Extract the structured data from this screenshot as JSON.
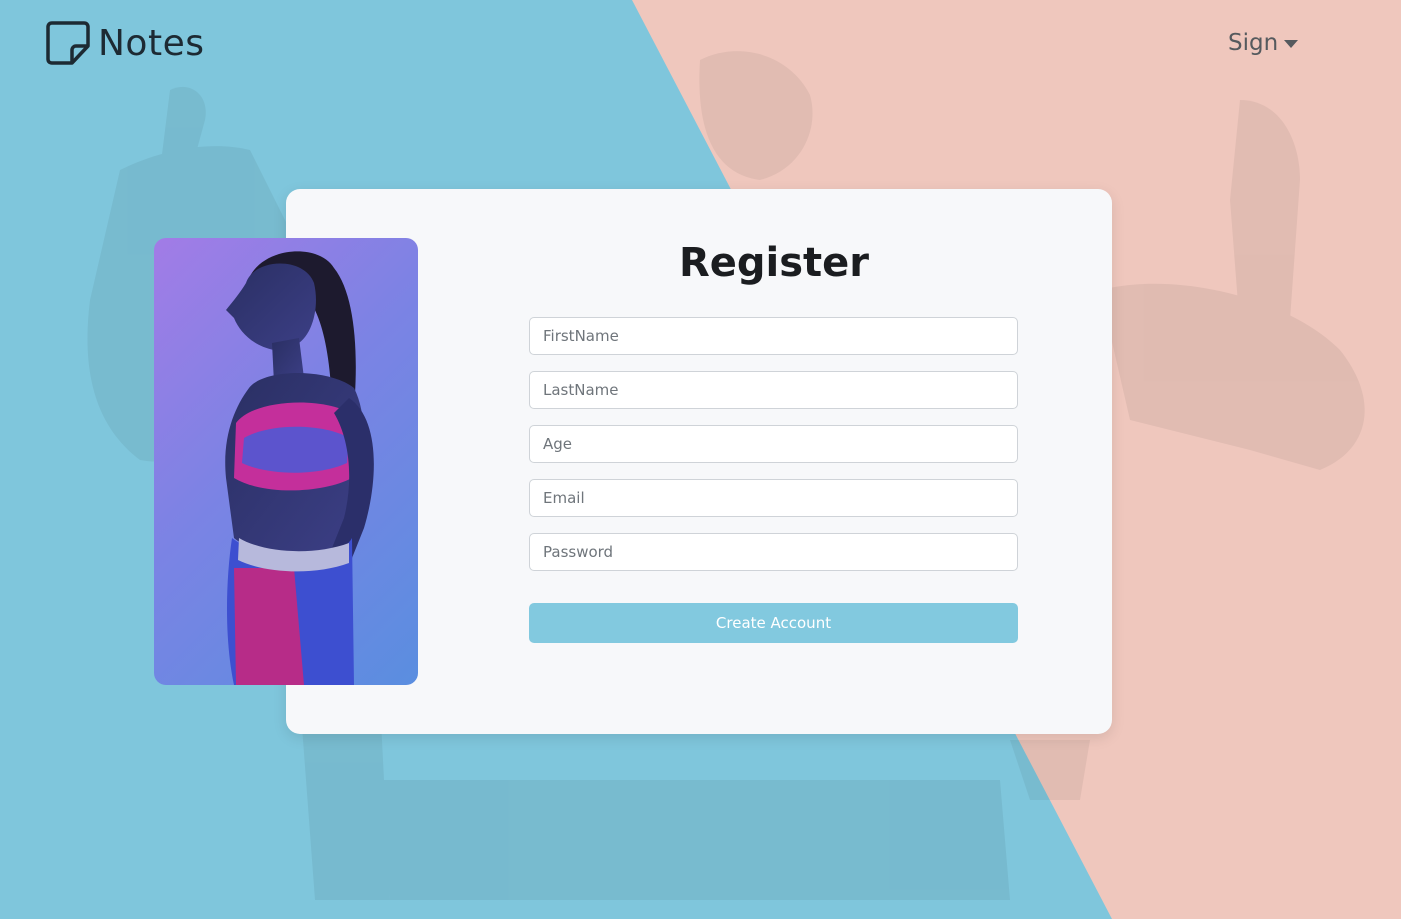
{
  "navbar": {
    "brand_label": "Notes",
    "brand_icon": "sticky-note-icon",
    "sign_label": "Sign",
    "sign_icon": "caret-down-icon"
  },
  "register": {
    "title": "Register",
    "fields": {
      "first_name_placeholder": "FirstName",
      "last_name_placeholder": "LastName",
      "age_placeholder": "Age",
      "email_placeholder": "Email",
      "password_placeholder": "Password"
    },
    "submit_label": "Create Account"
  },
  "colors": {
    "background_blue": "#7fc6dc",
    "background_pink": "#efc7bd",
    "card": "#f7f8fa",
    "button": "#82c9df"
  }
}
